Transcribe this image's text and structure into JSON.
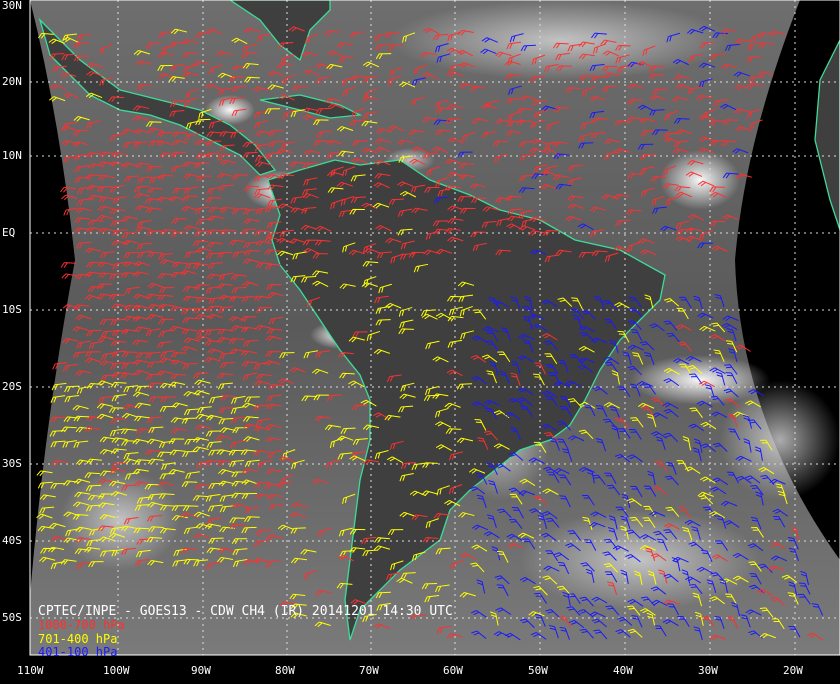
{
  "map": {
    "caption": "CPTEC/INPE - GOES13 - CDW CH4 (IR) 20141201 14:30 UTC",
    "legend": [
      {
        "label": "1000-700 hPa",
        "color": "#ff3030"
      },
      {
        "label": "701-400 hPa",
        "color": "#ffff00"
      },
      {
        "label": "401-100 hPa",
        "color": "#1a1aff"
      }
    ],
    "lat_labels": [
      "30N",
      "20N",
      "10N",
      "EQ",
      "10S",
      "20S",
      "30S",
      "40S",
      "50S"
    ],
    "lon_labels": [
      "110W",
      "100W",
      "90W",
      "80W",
      "70W",
      "60W",
      "50W",
      "40W",
      "30W",
      "20W"
    ],
    "colors": {
      "coastline": "#3ddc9a",
      "grid": "#dddddd",
      "space": "#000000"
    }
  }
}
